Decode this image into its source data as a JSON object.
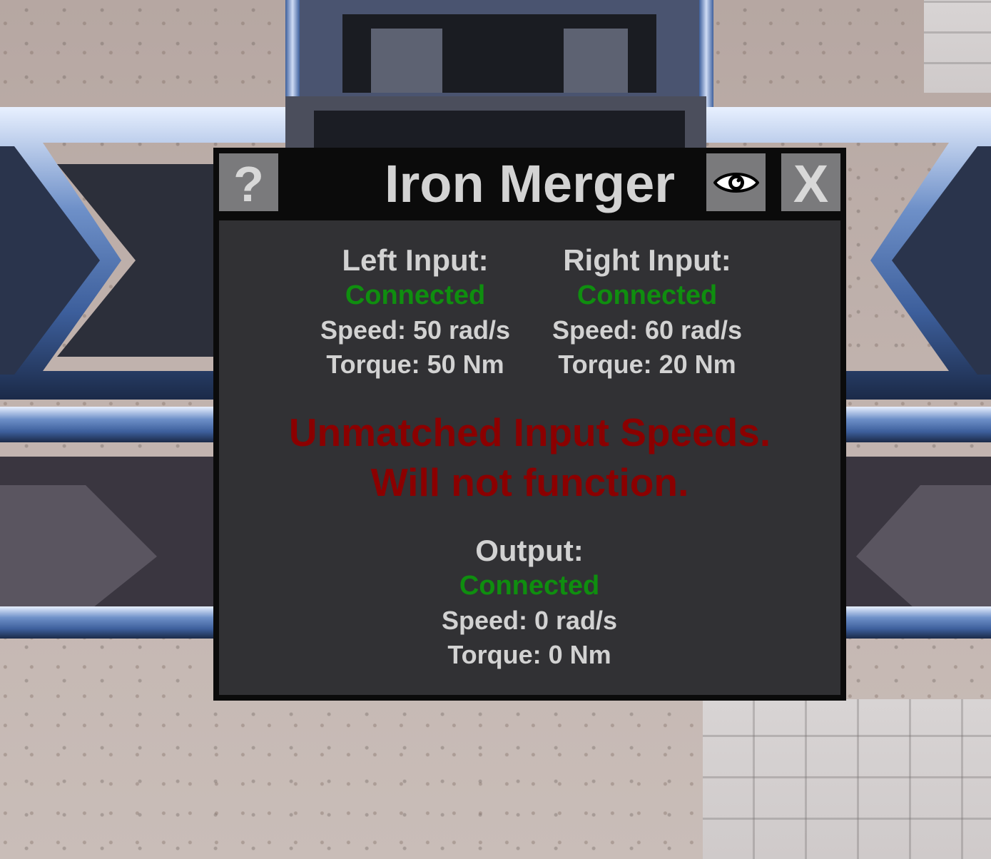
{
  "window": {
    "title": "Iron Merger",
    "help_label": "?",
    "close_label": "X"
  },
  "left_input": {
    "heading": "Left Input:",
    "status": "Connected",
    "speed": "Speed: 50 rad/s",
    "torque": "Torque: 50 Nm"
  },
  "right_input": {
    "heading": "Right Input:",
    "status": "Connected",
    "speed": "Speed: 60 rad/s",
    "torque": "Torque: 20 Nm"
  },
  "warning": {
    "line1": "Unmatched Input Speeds.",
    "line2": "Will not function."
  },
  "output": {
    "heading": "Output:",
    "status": "Connected",
    "speed": "Speed: 0 rad/s",
    "torque": "Torque: 0 Nm"
  },
  "colors": {
    "connected": "#0f8e0f",
    "warning": "#8b0000",
    "panel_bg": "#313134",
    "button_bg": "#7a7a7c"
  },
  "icons": {
    "help": "question-mark-icon",
    "visibility": "eye-icon",
    "close": "close-icon"
  }
}
